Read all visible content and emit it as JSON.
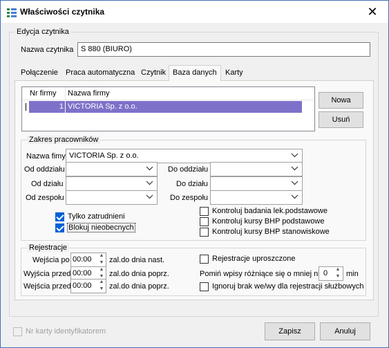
{
  "window": {
    "title": "Właściwości czytnika",
    "close_label": "✕"
  },
  "edycja": {
    "group_label": "Edycja czytnika",
    "name_label": "Nazwa czytnika",
    "name_value": "S 880 (BIURO)"
  },
  "tabs": [
    "Połączenie",
    "Praca automatyczna",
    "Czytnik",
    "Baza danych",
    "Karty"
  ],
  "active_tab": "Baza danych",
  "firmy": {
    "columns": [
      "Nr firmy",
      "Nazwa firmy"
    ],
    "rows": [
      {
        "nr": "1",
        "nazwa": "VICTORIA Sp. z o.o."
      }
    ],
    "btn_nowa": "Nowa",
    "btn_usun": "Usuń"
  },
  "zakres": {
    "group_label": "Zakres pracowników",
    "nazwa_firmy_label": "Nazwa fimy",
    "nazwa_firmy_value": "VICTORIA Sp. z o.o.",
    "od_oddzialu": "Od oddziału",
    "do_oddzialu": "Do oddziału",
    "od_dzialu": "Od działu",
    "do_dzialu": "Do działu",
    "od_zespolu": "Od zespołu",
    "do_zespolu": "Do zespołu",
    "tylko_zatrudnieni": "Tylko zatrudnieni",
    "blokuj_nieobecnych": "Blokuj nieobecnych",
    "kontroluj_badania": "Kontroluj badania lek.podstawowe",
    "kontroluj_bhp_podst": "Kontroluj kursy BHP podstawowe",
    "kontroluj_bhp_stan": "Kontroluj kursy BHP stanowiskowe"
  },
  "rejestracje": {
    "group_label": "Rejestracje",
    "wejscia_po_label": "Wejścia po",
    "wejscia_po_value": "00:00",
    "wejscia_po_suffix": "zal.do dnia nast.",
    "wyjscia_przed_label": "Wyjścia przed",
    "wyjscia_przed_value": "00:00",
    "wyjscia_przed_suffix": "zal.do dnia poprz.",
    "wejscia_przed_label": "Wejścia przed",
    "wejscia_przed_value": "00:00",
    "wejscia_przed_suffix": "zal.do dnia poprz.",
    "uproszczone": "Rejestracje uproszczone",
    "pomin_label": "Pomiń wpisy różniące się o mniej niż",
    "pomin_value": "0",
    "pomin_unit": "min",
    "ignoruj": "Ignoruj brak we/wy dla rejestracji służbowych"
  },
  "footer": {
    "nr_karty": "Nr karty identyfikatorem",
    "zapisz": "Zapisz",
    "anuluj": "Anuluj"
  }
}
